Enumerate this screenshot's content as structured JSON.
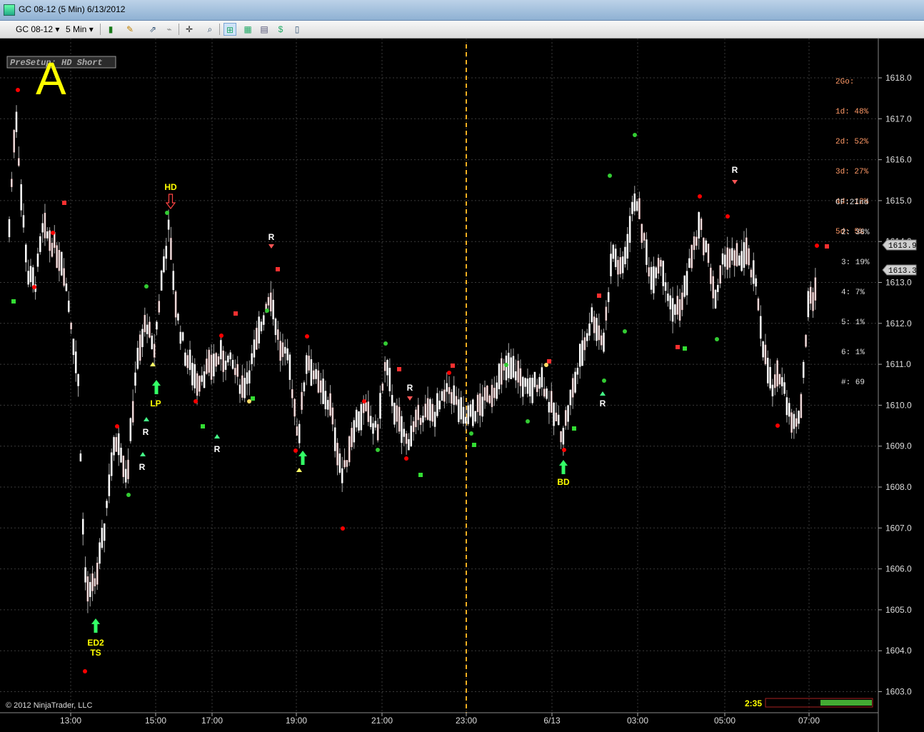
{
  "window": {
    "title": "GC 08-12 (5 Min)  6/13/2012"
  },
  "toolbar": {
    "instrument": "GC 08-12",
    "interval": "5 Min"
  },
  "chart": {
    "overlay_label": "PreSetup: HD Short",
    "big_letter": "A",
    "copyright": "© 2012 NinjaTrader, LLC",
    "countdown": "2:35",
    "y_ticks": [
      "1618.0",
      "1617.0",
      "1616.0",
      "1615.0",
      "1614.0",
      "1613.0",
      "1612.0",
      "1611.0",
      "1610.0",
      "1609.0",
      "1608.0",
      "1607.0",
      "1606.0",
      "1605.0",
      "1604.0",
      "1603.0"
    ],
    "x_ticks": [
      "13:00",
      "15:00",
      "17:00",
      "19:00",
      "21:00",
      "23:00",
      "6/13",
      "03:00",
      "05:00",
      "07:00"
    ],
    "price_tags": [
      "1613.9",
      "1613.3"
    ],
    "stats_2go": {
      "header": "2Go:",
      "rows": [
        "1d: 48%",
        "2d: 52%",
        "3d: 27%",
        "4d: 12%",
        "5d: 5%"
      ]
    },
    "stats_cf": {
      "header": "CF:2Ind",
      "rows": [
        "2: 38%",
        "3: 19%",
        "4: 7%",
        "5: 1%",
        "6: 1%",
        "#: 69"
      ]
    },
    "annotations": {
      "hd": "HD",
      "lp": "LP",
      "ed2": "ED2",
      "ts": "TS",
      "bd": "BD",
      "r": "R"
    },
    "colors": {
      "background": "#000000",
      "text_yellow": "#ffff00",
      "stats": "#ff9966",
      "dots_red": "#ff0000",
      "dots_green": "#33cc33"
    }
  }
}
